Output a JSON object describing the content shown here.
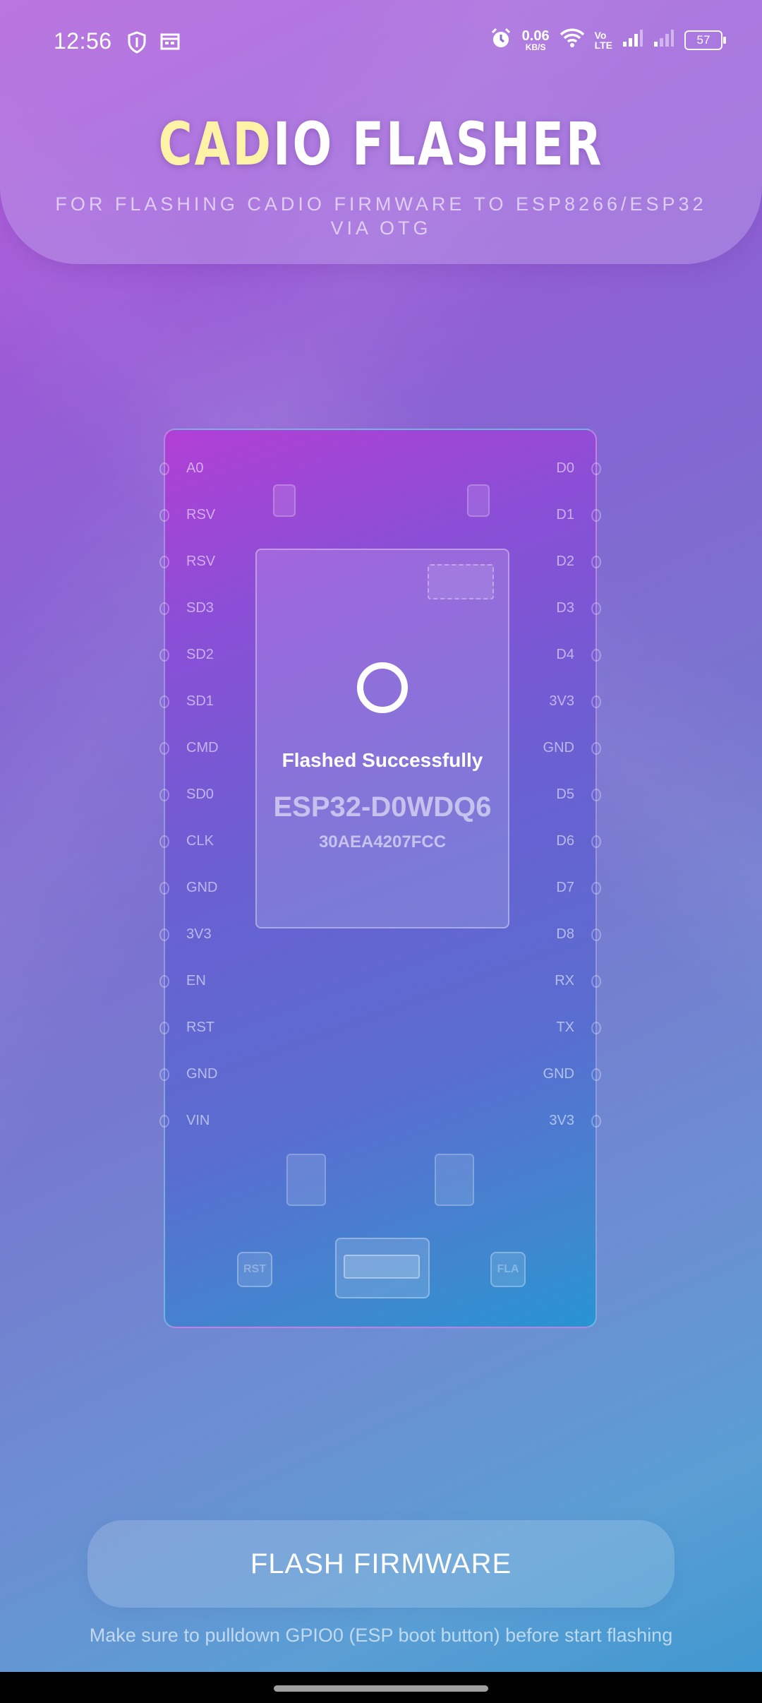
{
  "status_bar": {
    "time": "12:56",
    "net_speed": "0.06",
    "net_speed_unit": "KB/S",
    "volte_top": "Vo",
    "volte_bottom": "LTE",
    "battery": "57",
    "icons": [
      "shield-icon",
      "calendar-icon",
      "alarm-icon",
      "wifi-icon",
      "signal-icon",
      "signal-weak-icon",
      "battery-icon"
    ]
  },
  "header": {
    "title_highlight": "CAD",
    "title_rest": "IO FLASHER",
    "subtitle": "FOR FLASHING CADIO FIRMWARE TO ESP8266/ESP32 VIA OTG"
  },
  "board": {
    "left_pins": [
      "A0",
      "RSV",
      "RSV",
      "SD3",
      "SD2",
      "SD1",
      "CMD",
      "SD0",
      "CLK",
      "GND",
      "3V3",
      "EN",
      "RST",
      "GND",
      "VIN"
    ],
    "right_pins": [
      "D0",
      "D1",
      "D2",
      "D3",
      "D4",
      "3V3",
      "GND",
      "D5",
      "D6",
      "D7",
      "D8",
      "RX",
      "TX",
      "GND",
      "3V3"
    ],
    "chip": {
      "status": "Flashed Successfully",
      "model": "ESP32-D0WDQ6",
      "mac": "30AEA4207FCC"
    },
    "rst_label": "RST",
    "flash_label": "FLA"
  },
  "actions": {
    "flash_button": "FLASH FIRMWARE",
    "hint": "Make sure to pulldown GPIO0 (ESP boot button) before start flashing"
  },
  "colors": {
    "title_highlight": "#fdf2a6",
    "background_top": "#b552d8",
    "background_bottom": "#3c97cf"
  }
}
